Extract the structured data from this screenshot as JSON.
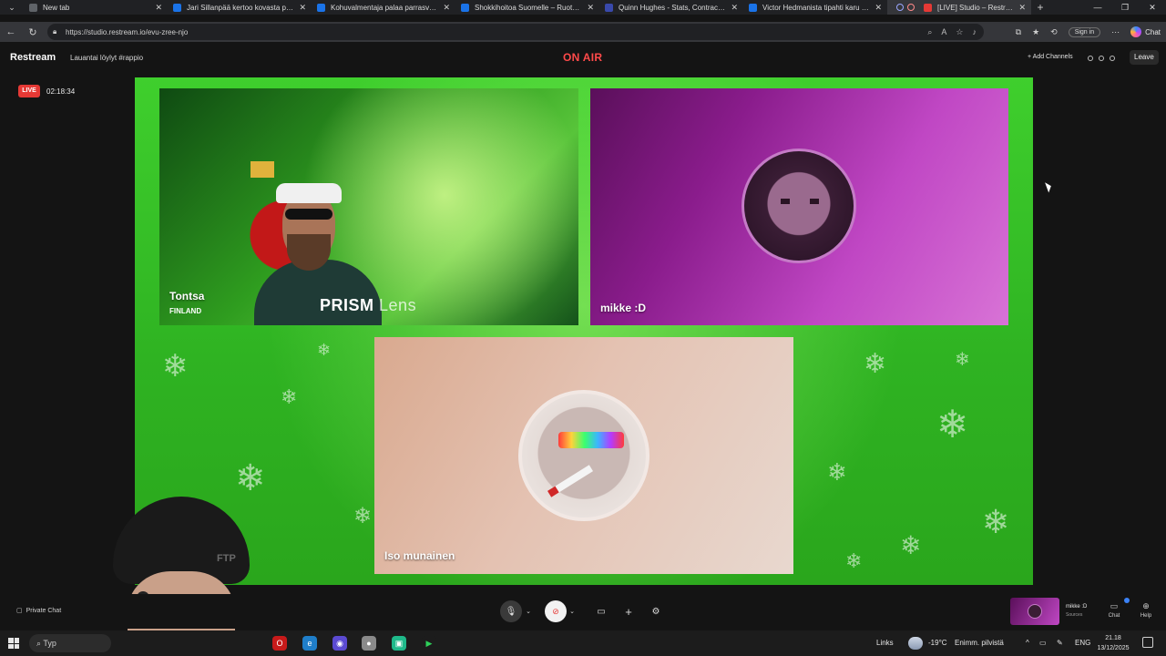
{
  "browser": {
    "tabs": [
      {
        "title": "New tab",
        "favicon_color": "#5f6368"
      },
      {
        "title": "Jari Sillanpää kertoo kovasta paikasta",
        "favicon_color": "#1a73e8"
      },
      {
        "title": "Kohuvalmentaja palaa parrasvaloihin",
        "favicon_color": "#1a73e8"
      },
      {
        "title": "Shokkihoitoa Suomelle – Ruotsi pyyhki",
        "favicon_color": "#1a73e8"
      },
      {
        "title": "Quinn Hughes - Stats, Contract, Salary",
        "favicon_color": "#3949ab"
      },
      {
        "title": "Victor Hedmanista tipahti karu uutinen",
        "favicon_color": "#1a73e8"
      },
      {
        "title": "[LIVE] Studio – Restream",
        "favicon_color": "#e53935",
        "active": true
      }
    ],
    "url": "https://studio.restream.io/evu-zree-njo",
    "sign_in": "Sign in",
    "copilot": "Chat"
  },
  "studio": {
    "brand": "Restream",
    "stream_title": "Lauantai löylyt #rappio",
    "on_air": "ON AIR",
    "add_channels": "+ Add Channels",
    "leave": "Leave",
    "live_badge": "LIVE",
    "timer": "02:18:34",
    "accent_on_air": "#ff4a4a"
  },
  "participants": [
    {
      "name": "Tontsa",
      "subtitle": "FINLAND",
      "overlay": {
        "brand": "PRISM",
        "suffix": "Lens"
      }
    },
    {
      "name": "mikke :D"
    },
    {
      "name": "Iso munainen"
    }
  ],
  "webcam_overlay": {
    "cap_text": "FTP"
  },
  "bottom_bar": {
    "private_chat": "Private Chat",
    "self_name": "mikke :D",
    "self_sub": "Sources",
    "chat": "Chat",
    "help": "Help"
  },
  "taskbar": {
    "search": "Typ",
    "links": "Links",
    "weather_temp": "-19°C",
    "weather_desc": "Enimm. pilvistä",
    "lang": "ENG",
    "time": "21.18",
    "date": "13/12/2025"
  }
}
